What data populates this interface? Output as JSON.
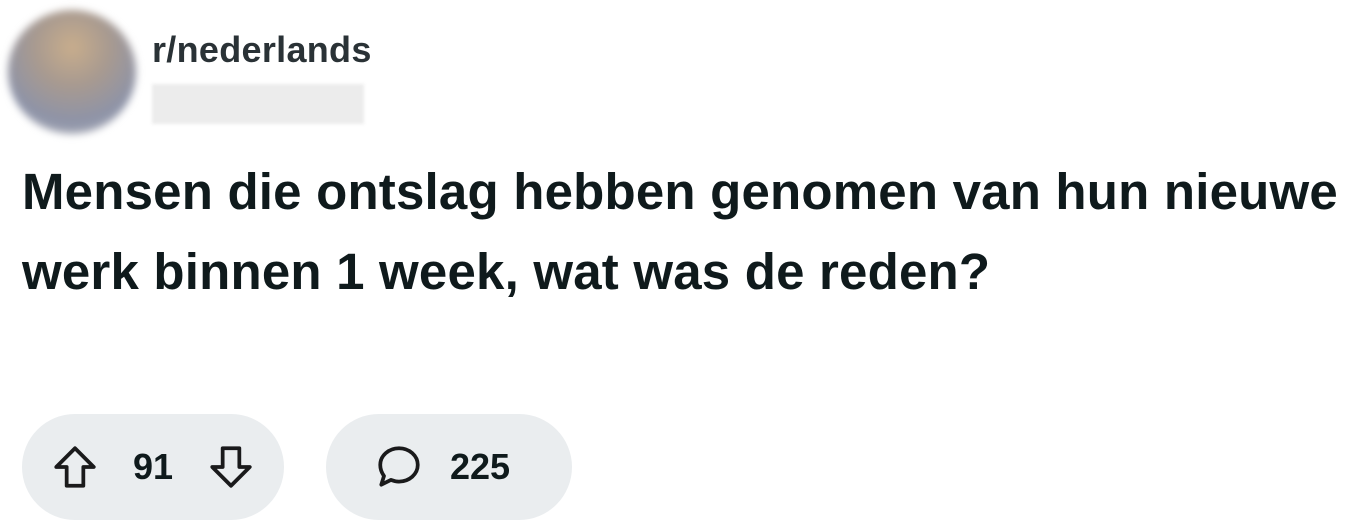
{
  "post": {
    "subreddit": "r/nederlands",
    "title": "Mensen die ontslag hebben genomen van hun nieuwe werk binnen 1 week, wat was de reden?",
    "upvotes": "91",
    "comments": "225"
  },
  "icons": {
    "upvote": "arrow-up-outline-icon",
    "downvote": "arrow-down-outline-icon",
    "comment": "speech-bubble-icon"
  },
  "colors": {
    "pill_bg": "#eaedef",
    "text": "#0f1a1c"
  }
}
